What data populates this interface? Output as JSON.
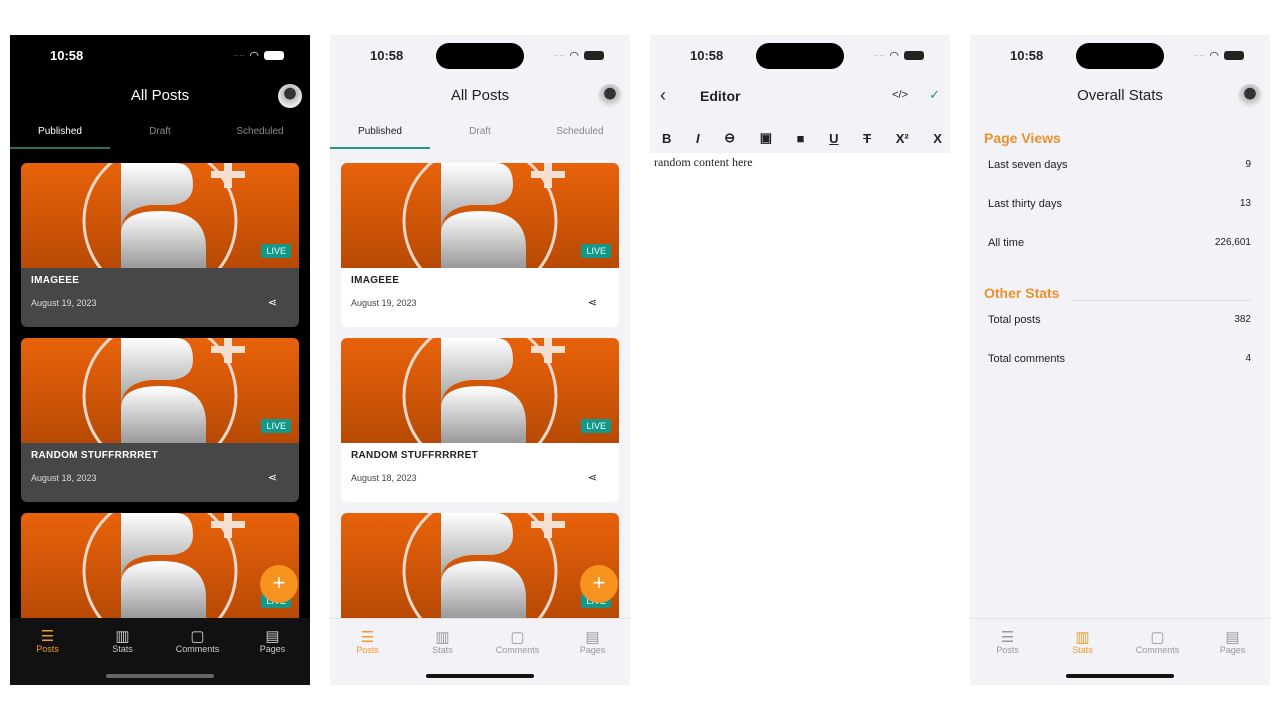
{
  "status_time": "10:58",
  "posts_screen": {
    "title": "All Posts",
    "tabs": [
      "Published",
      "Draft",
      "Scheduled"
    ],
    "posts": [
      {
        "title": "IMAGEEE",
        "date": "August 19, 2023",
        "badge": "LIVE"
      },
      {
        "title": "RANDOM STUFFRRRRET",
        "date": "August 18, 2023",
        "badge": "LIVE"
      },
      {
        "title": "",
        "date": "",
        "badge": "LIVE"
      }
    ],
    "fab": "+"
  },
  "nav": [
    {
      "label": "Posts",
      "icon": "posts-icon"
    },
    {
      "label": "Stats",
      "icon": "stats-icon"
    },
    {
      "label": "Comments",
      "icon": "comment-icon"
    },
    {
      "label": "Pages",
      "icon": "pages-icon"
    }
  ],
  "editor": {
    "title": "Editor",
    "toolbar": [
      "B",
      "I",
      "link",
      "image",
      "video",
      "U",
      "strikethrough",
      "X²",
      "X"
    ],
    "content": "random content here"
  },
  "stats": {
    "title": "Overall Stats",
    "page_views": {
      "heading": "Page Views",
      "rows": [
        {
          "label": "Last seven days",
          "value": "9"
        },
        {
          "label": "Last thirty days",
          "value": "13"
        },
        {
          "label": "All time",
          "value": "226,601"
        }
      ]
    },
    "other": {
      "heading": "Other Stats",
      "rows": [
        {
          "label": "Total posts",
          "value": "382"
        },
        {
          "label": "Total comments",
          "value": "4"
        }
      ]
    }
  },
  "colors": {
    "accent": "#f7931e",
    "live": "#13988a",
    "tab_indicator": "#1f9a88"
  }
}
